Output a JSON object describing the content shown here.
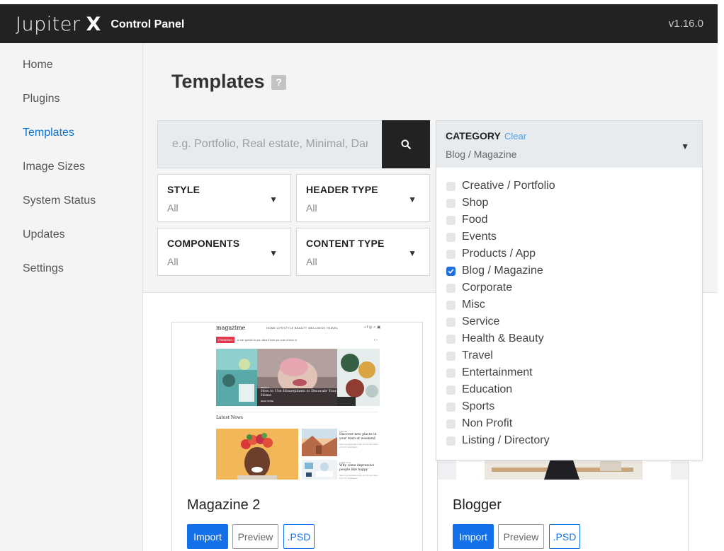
{
  "header": {
    "brand": "Jupiter",
    "brand_mark": "X",
    "subtitle": "Control Panel",
    "version": "v1.16.0"
  },
  "sidebar": {
    "active": "Templates",
    "items": [
      {
        "label": "Home"
      },
      {
        "label": "Plugins"
      },
      {
        "label": "Templates"
      },
      {
        "label": "Image Sizes"
      },
      {
        "label": "System Status"
      },
      {
        "label": "Updates"
      },
      {
        "label": "Settings"
      }
    ]
  },
  "main": {
    "title": "Templates",
    "help": "?",
    "search": {
      "placeholder": "e.g. Portfolio, Real estate, Minimal, Dark",
      "value": "",
      "icon": "search-icon"
    },
    "filters": {
      "style": {
        "title": "STYLE",
        "value": "All"
      },
      "header_type": {
        "title": "HEADER TYPE",
        "value": "All"
      },
      "components": {
        "title": "COMPONENTS",
        "value": "All"
      },
      "content_type": {
        "title": "CONTENT TYPE",
        "value": "All"
      }
    },
    "category": {
      "title": "CATEGORY",
      "clear_label": "Clear",
      "value": "Blog / Magazine",
      "options": [
        {
          "label": "Creative / Portfolio",
          "checked": false
        },
        {
          "label": "Shop",
          "checked": false
        },
        {
          "label": "Food",
          "checked": false
        },
        {
          "label": "Events",
          "checked": false
        },
        {
          "label": "Products / App",
          "checked": false
        },
        {
          "label": "Blog / Magazine",
          "checked": true
        },
        {
          "label": "Corporate",
          "checked": false
        },
        {
          "label": "Misc",
          "checked": false
        },
        {
          "label": "Service",
          "checked": false
        },
        {
          "label": "Health & Beauty",
          "checked": false
        },
        {
          "label": "Travel",
          "checked": false
        },
        {
          "label": "Entertainment",
          "checked": false
        },
        {
          "label": "Education",
          "checked": false
        },
        {
          "label": "Sports",
          "checked": false
        },
        {
          "label": "Non Profit",
          "checked": false
        },
        {
          "label": "Listing / Directory",
          "checked": false
        }
      ]
    },
    "cards": [
      {
        "title": "Magazine 2",
        "import_label": "Import",
        "preview_label": "Preview",
        "psd_label": ".PSD",
        "thumb": {
          "logo": "magazime",
          "menu": "HOME    LIFESTYLE    BEAUTY    WELLNESS    TRAVEL",
          "social": "⌕  f  ◎  ✓  ▣",
          "trending": "TRENDING",
          "trending_text": "It can speak to you about how you can check in",
          "arrows": "‹  ›",
          "caption_kicker": "BEAUTY",
          "caption_title": "How to Use Houseplants to Decorate Your Home",
          "caption_meta": "READ MORE",
          "latest": "Latest News",
          "news1_kicker": "TRAVEL",
          "news1_title": "Discover new places in your town at weekend",
          "news1_sub": "Sed ut perspiciatis unde omnis iste natus error sit voluptatem",
          "news2_kicker": "LIFESTYLE",
          "news2_title": "Why some depressive people like happy",
          "news2_sub": "Sed ut perspiciatis unde omnis iste natus error sit voluptatem"
        }
      },
      {
        "title": "Blogger",
        "import_label": "Import",
        "preview_label": "Preview",
        "psd_label": ".PSD"
      }
    ]
  },
  "colors": {
    "topbar": "#222222",
    "accent": "#1470e8",
    "active_nav": "#0a74d6",
    "panel_bg": "#f4f4f4",
    "magazine_red": "#e2374c"
  }
}
